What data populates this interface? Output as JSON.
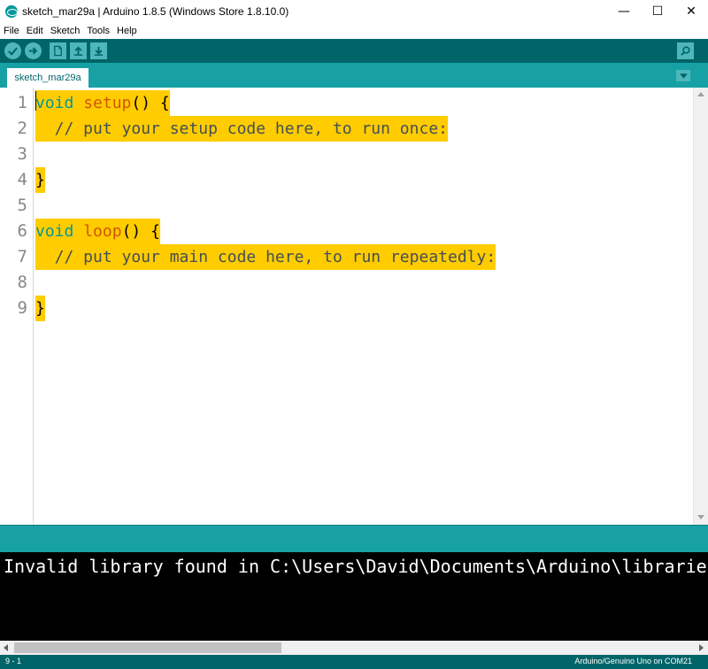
{
  "window": {
    "title": "sketch_mar29a | Arduino 1.8.5 (Windows Store 1.8.10.0)",
    "controls": {
      "minimize": "—",
      "maximize": "☐",
      "close": "✕"
    }
  },
  "menu": {
    "items": [
      "File",
      "Edit",
      "Sketch",
      "Tools",
      "Help"
    ]
  },
  "toolbar": {
    "buttons": [
      "verify-icon",
      "upload-icon",
      "new-icon",
      "open-icon",
      "save-icon"
    ],
    "serial_monitor_icon": "magnifier-icon"
  },
  "tabs": {
    "active": "sketch_mar29a",
    "menu_icon": "chevron-down-icon"
  },
  "editor": {
    "line_numbers": [
      "1",
      "2",
      "3",
      "4",
      "5",
      "6",
      "7",
      "8",
      "9"
    ],
    "lines": [
      {
        "kw": "void",
        "fn": "setup",
        "rest": "() {"
      },
      {
        "comment": "  // put your setup code here, to run once:"
      },
      {
        "text": ""
      },
      {
        "text": "}"
      },
      {
        "text": ""
      },
      {
        "kw": "void",
        "fn": "loop",
        "rest": "() {"
      },
      {
        "comment": "  // put your main code here, to run repeatedly:"
      },
      {
        "text": ""
      },
      {
        "text": "}"
      }
    ],
    "selection_color": "#ffcc00",
    "keyword_color": "#00979c",
    "function_color": "#d35400"
  },
  "console": {
    "text": "Invalid library found in C:\\Users\\David\\Documents\\Arduino\\libraries"
  },
  "status": {
    "position": "9 - 1",
    "board": "Arduino/Genuino Uno on COM21"
  },
  "colors": {
    "toolbar": "#006468",
    "tabbar": "#17a1a5",
    "accent": "#00979c"
  }
}
